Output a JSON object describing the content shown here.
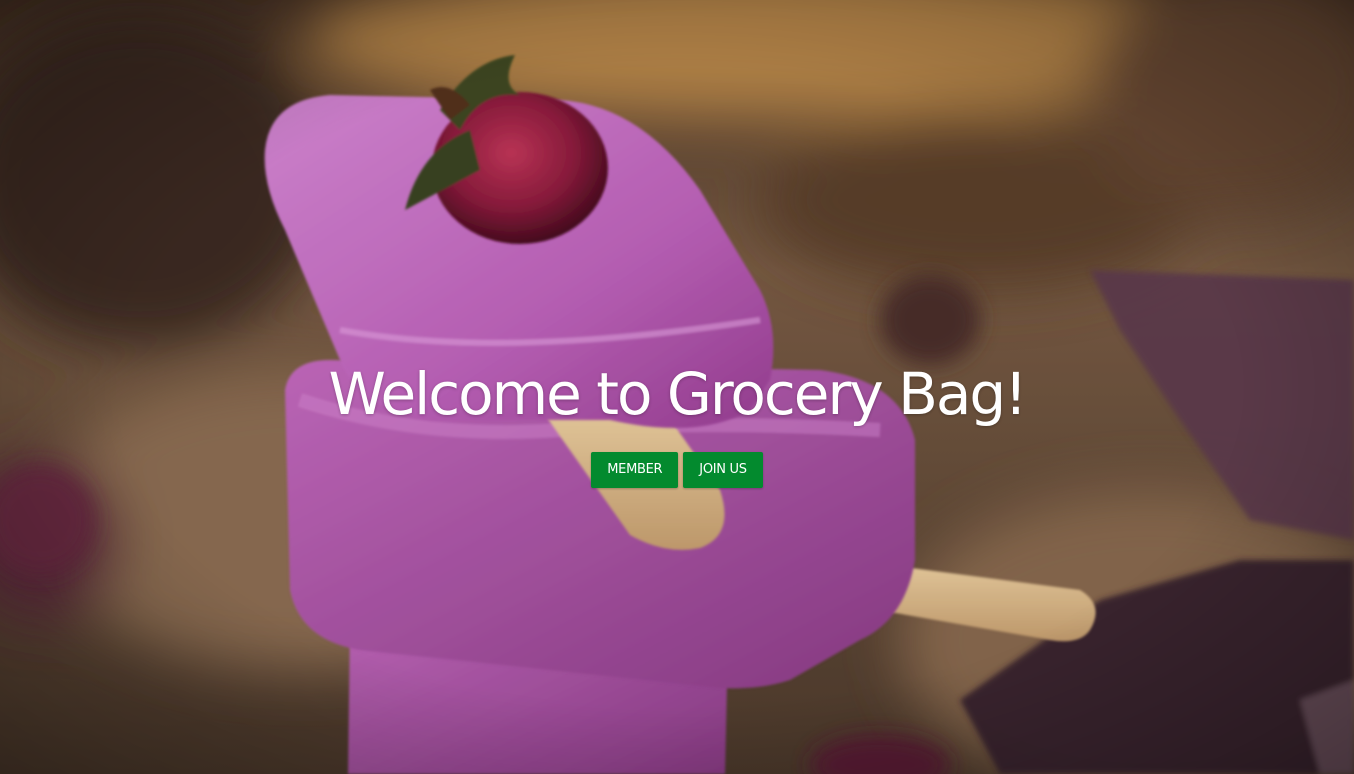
{
  "hero": {
    "title": "Welcome to Grocery Bag!",
    "background_image": "purple-berry-ice-cream-popsicles",
    "buttons": {
      "member": "MEMBER",
      "join": "JOIN US"
    }
  },
  "colors": {
    "button_bg": "#038a2e",
    "title_text": "#ffffff"
  }
}
